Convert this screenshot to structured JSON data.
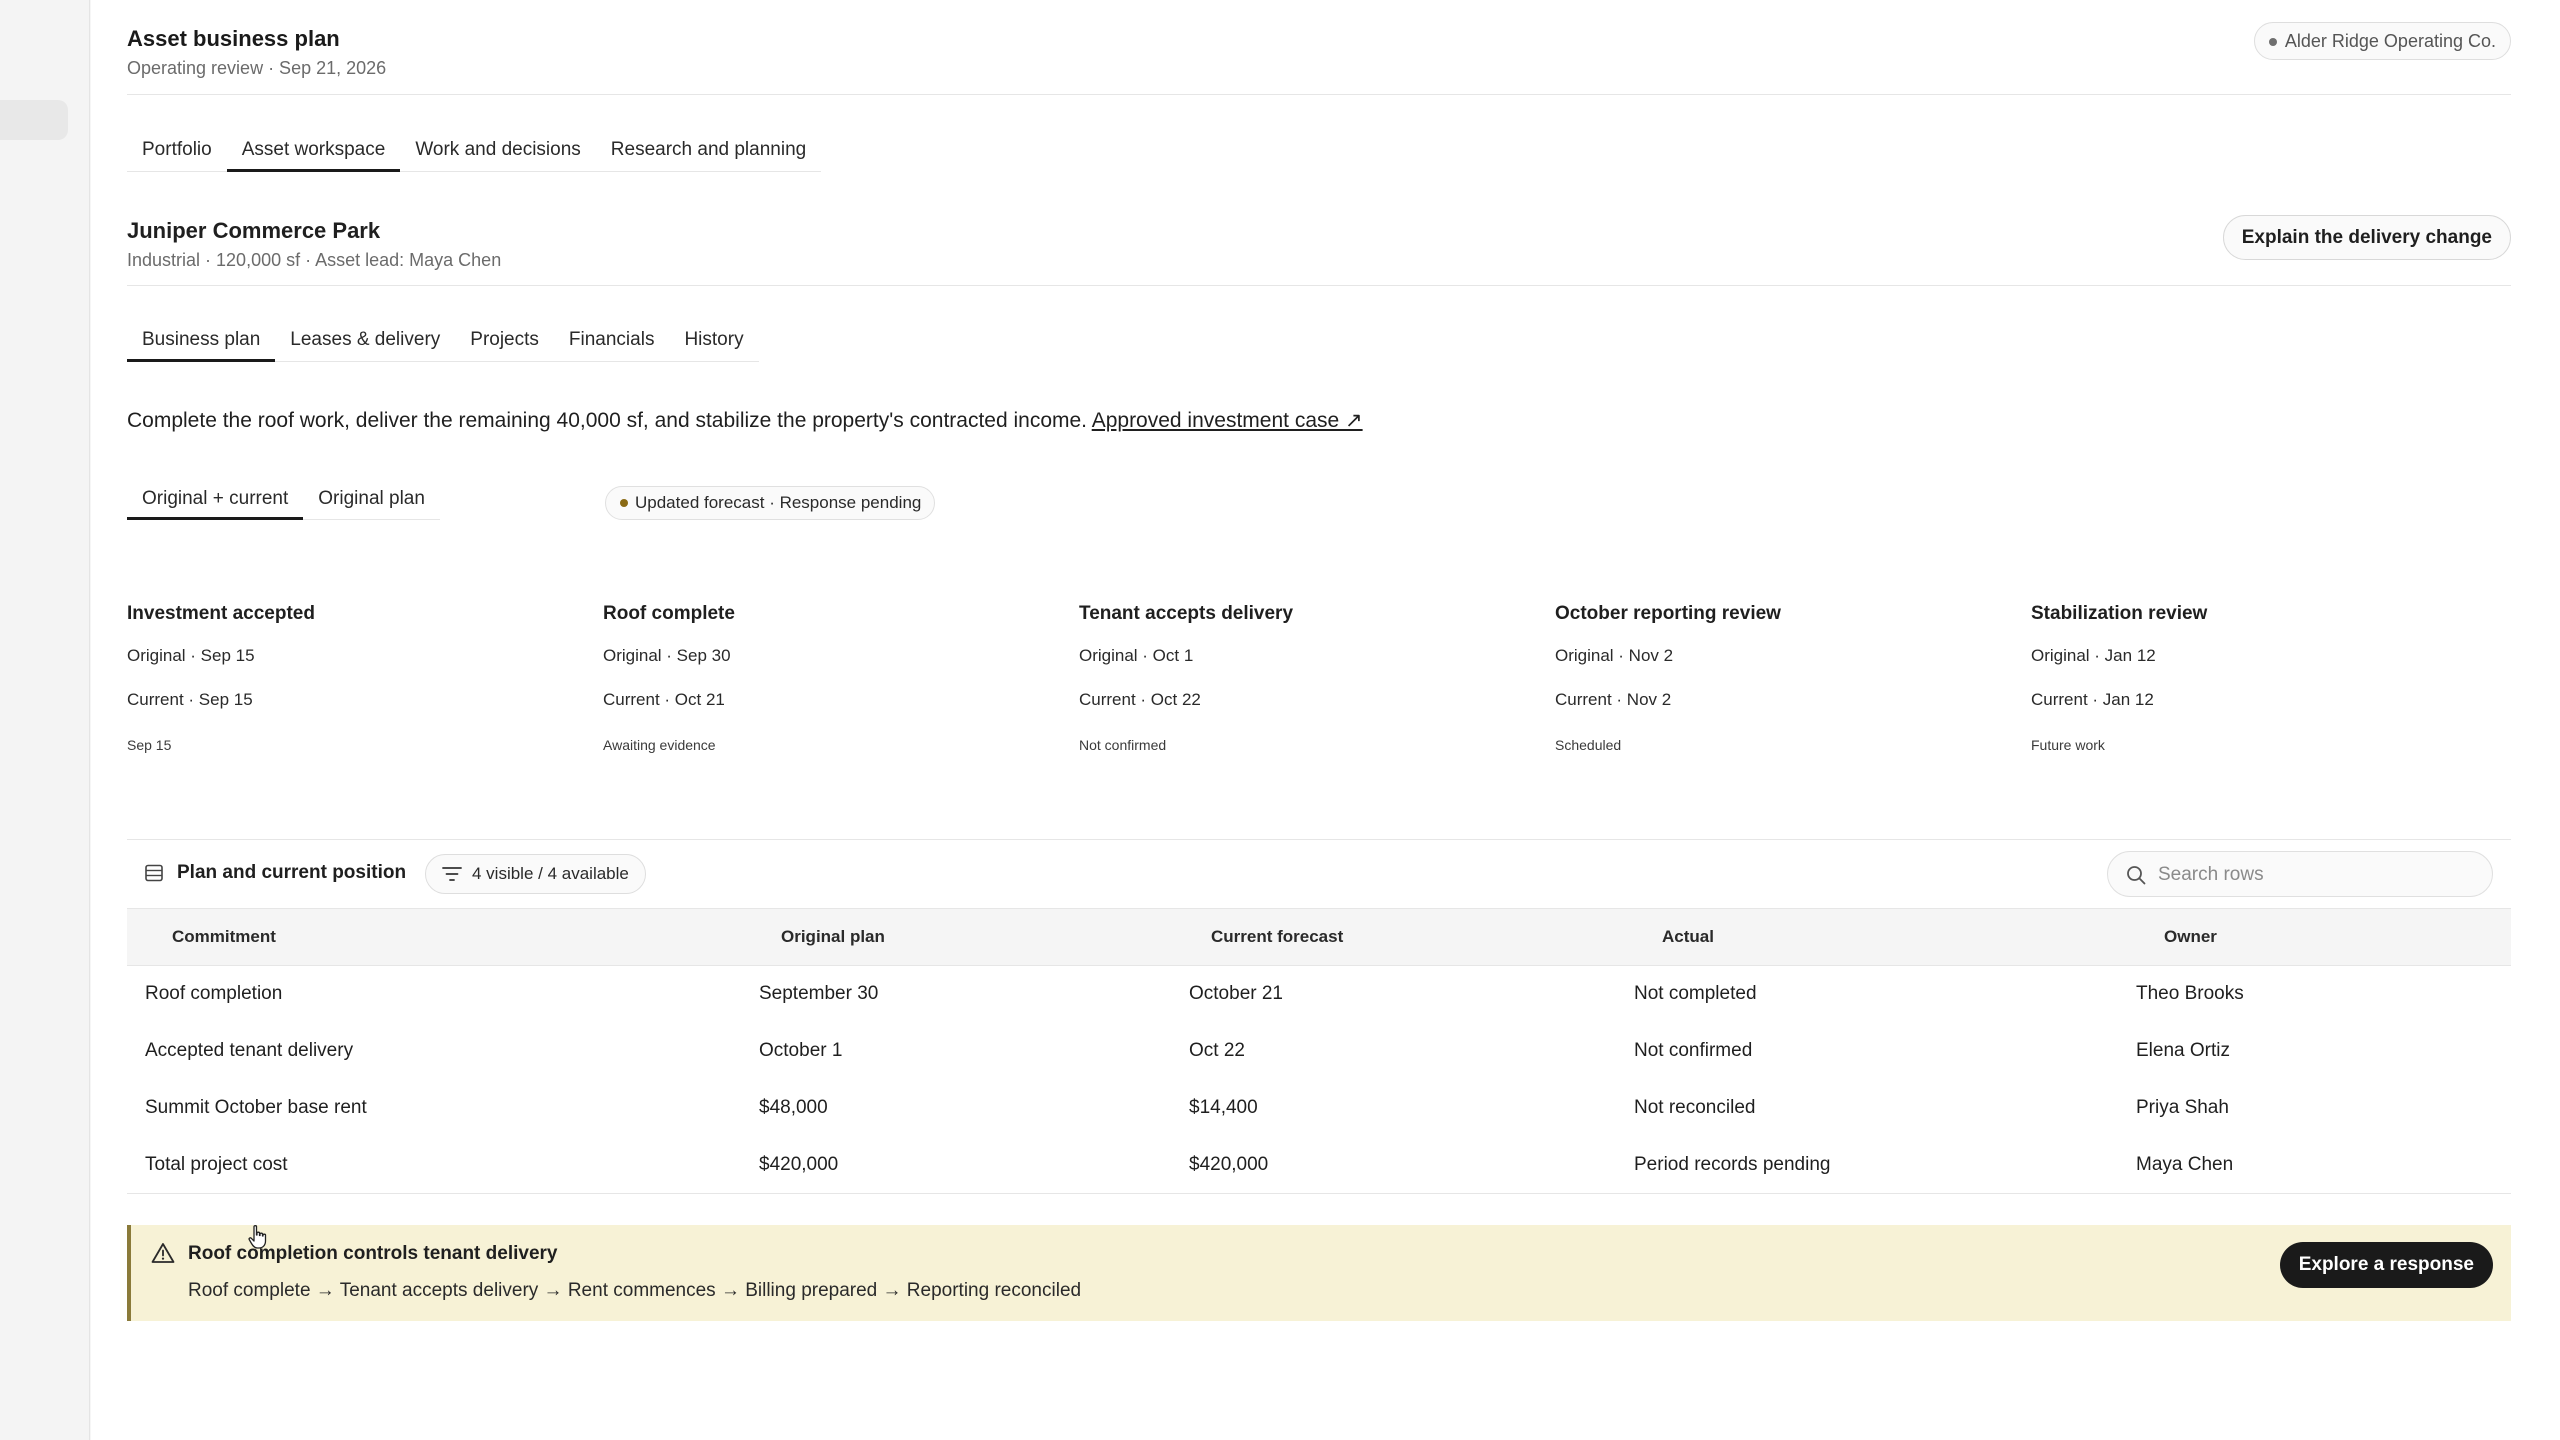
{
  "header": {
    "title": "Asset business plan",
    "subtitle": "Operating review · Sep 21, 2026",
    "org": "Alder Ridge Operating Co."
  },
  "top_tabs": [
    {
      "label": "Portfolio",
      "active": false
    },
    {
      "label": "Asset workspace",
      "active": true
    },
    {
      "label": "Work and decisions",
      "active": false
    },
    {
      "label": "Research and planning",
      "active": false
    }
  ],
  "asset": {
    "name": "Juniper Commerce Park",
    "meta": "Industrial · 120,000 sf · Asset lead: Maya Chen",
    "action_label": "Explain the delivery change"
  },
  "asset_tabs": [
    {
      "label": "Business plan",
      "active": true
    },
    {
      "label": "Leases & delivery",
      "active": false
    },
    {
      "label": "Projects",
      "active": false
    },
    {
      "label": "Financials",
      "active": false
    },
    {
      "label": "History",
      "active": false
    }
  ],
  "summary": {
    "text": "Complete the roof work, deliver the remaining 40,000 sf, and stabilize the property's contracted income.",
    "link_label": "Approved investment case ↗"
  },
  "plan_tabs": [
    {
      "label": "Original + current",
      "active": true
    },
    {
      "label": "Original plan",
      "active": false
    }
  ],
  "status_pill": "Updated forecast · Response pending",
  "milestones": [
    {
      "title": "Investment accepted",
      "original": "Original · Sep 15",
      "current": "Current · Sep 15",
      "note": "Sep 15"
    },
    {
      "title": "Roof complete",
      "original": "Original · Sep 30",
      "current": "Current · Oct 21",
      "note": "Awaiting evidence"
    },
    {
      "title": "Tenant accepts delivery",
      "original": "Original · Oct 1",
      "current": "Current · Oct 22",
      "note": "Not confirmed"
    },
    {
      "title": "October reporting review",
      "original": "Original · Nov 2",
      "current": "Current · Nov 2",
      "note": "Scheduled"
    },
    {
      "title": "Stabilization review",
      "original": "Original · Jan 12",
      "current": "Current · Jan 12",
      "note": "Future work"
    }
  ],
  "table": {
    "title": "Plan and current position",
    "filter_label": "4 visible / 4 available",
    "search_placeholder": "Search rows",
    "columns": [
      "Commitment",
      "Original plan",
      "Current forecast",
      "Actual",
      "Owner"
    ],
    "rows": [
      [
        "Roof completion",
        "September 30",
        "October 21",
        "Not completed",
        "Theo Brooks"
      ],
      [
        "Accepted tenant delivery",
        "October 1",
        "Oct 22",
        "Not confirmed",
        "Elena Ortiz"
      ],
      [
        "Summit October base rent",
        "$48,000",
        "$14,400",
        "Not reconciled",
        "Priya Shah"
      ],
      [
        "Total project cost",
        "$420,000",
        "$420,000",
        "Period records pending",
        "Maya Chen"
      ]
    ]
  },
  "callout": {
    "title": "Roof completion controls tenant delivery",
    "flow": "Roof complete → Tenant accepts delivery → Rent commences → Billing prepared → Reporting reconciled",
    "action_label": "Explore a response"
  }
}
